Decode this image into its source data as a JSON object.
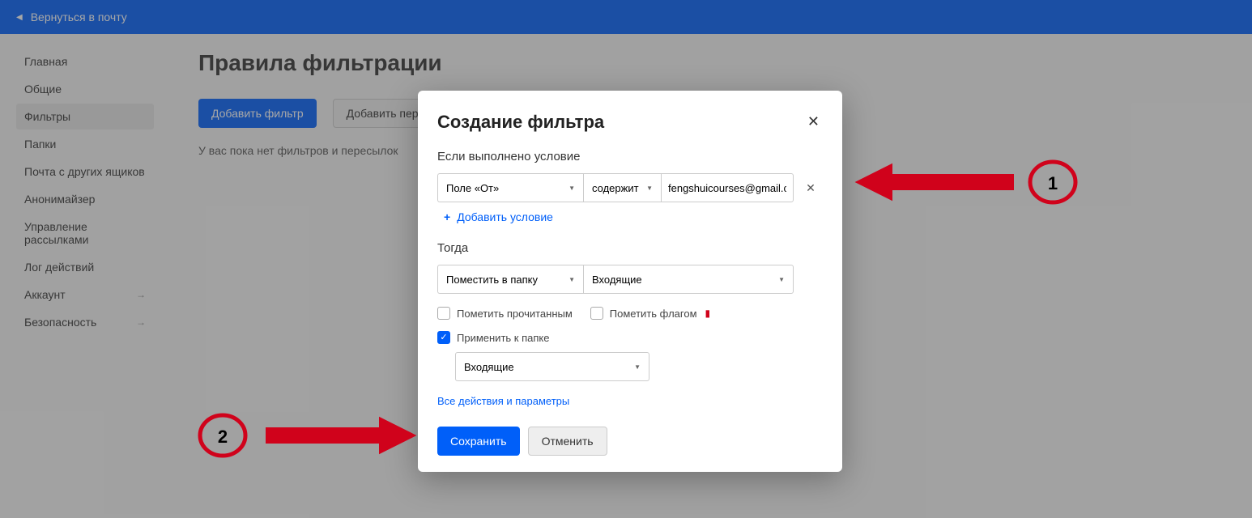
{
  "topbar": {
    "back": "Вернуться в почту"
  },
  "sidebar": {
    "items": [
      {
        "label": "Главная",
        "arrow": false
      },
      {
        "label": "Общие",
        "arrow": false
      },
      {
        "label": "Фильтры",
        "arrow": false
      },
      {
        "label": "Папки",
        "arrow": false
      },
      {
        "label": "Почта с других ящиков",
        "arrow": false
      },
      {
        "label": "Анонимайзер",
        "arrow": false
      },
      {
        "label": "Управление рассылками",
        "arrow": false
      },
      {
        "label": "Лог действий",
        "arrow": false
      },
      {
        "label": "Аккаунт",
        "arrow": true
      },
      {
        "label": "Безопасность",
        "arrow": true
      }
    ],
    "active_index": 2
  },
  "page": {
    "title": "Правила фильтрации",
    "add_filter_btn": "Добавить фильтр",
    "add_forward_btn": "Добавить пересылку",
    "empty_text": "У вас пока нет фильтров и пересылок"
  },
  "modal": {
    "title": "Создание фильтра",
    "cond_heading": "Если выполнено условие",
    "cond_field": "Поле «От»",
    "cond_op": "содержит",
    "cond_value": "fengshuicourses@gmail.com",
    "add_cond": "Добавить условие",
    "then_heading": "Тогда",
    "then_action": "Поместить в папку",
    "then_folder": "Входящие",
    "mark_read": "Пометить прочитанным",
    "mark_flag": "Пометить флагом",
    "apply_folder": "Применить к папке",
    "apply_folder_value": "Входящие",
    "all_actions": "Все действия и параметры",
    "save": "Сохранить",
    "cancel": "Отменить"
  },
  "annotations": {
    "n1": "1",
    "n2": "2"
  }
}
